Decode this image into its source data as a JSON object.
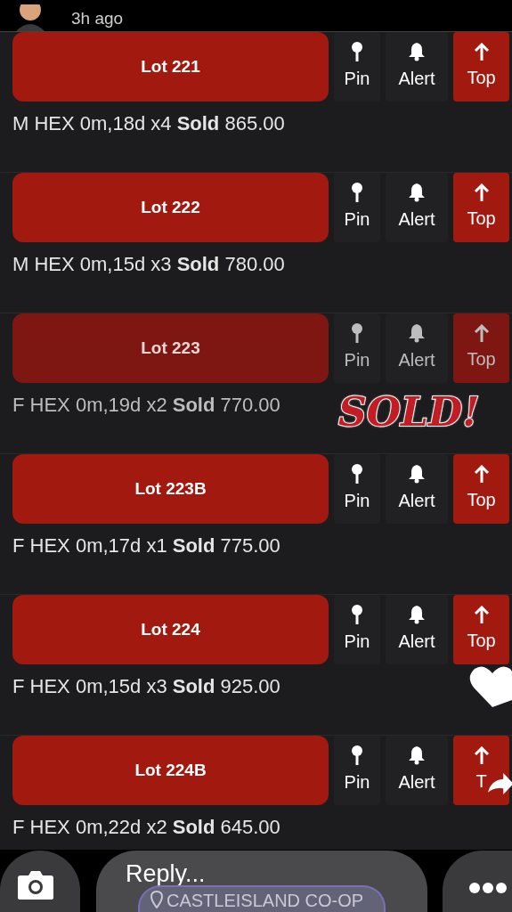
{
  "story_header": {
    "time": "3h ago"
  },
  "lots": [
    {
      "lot": "Lot 221",
      "description": "M HEX 0m,18d x4 **Sold** 865.00",
      "dimmed": false,
      "pin": "Pin",
      "alert": "Alert",
      "top": "Top"
    },
    {
      "lot": "Lot 222",
      "description": "M HEX 0m,15d x3 **Sold** 780.00",
      "dimmed": false,
      "pin": "Pin",
      "alert": "Alert",
      "top": "Top"
    },
    {
      "lot": "Lot 223",
      "description": "F HEX 0m,19d x2 **Sold** 770.00",
      "dimmed": true,
      "pin": "Pin",
      "alert": "Alert",
      "top": "Top"
    },
    {
      "lot": "Lot 223B",
      "description": "F HEX 0m,17d x1 **Sold** 775.00",
      "dimmed": false,
      "pin": "Pin",
      "alert": "Alert",
      "top": "Top"
    },
    {
      "lot": "Lot 224",
      "description": "F HEX 0m,15d x3 **Sold** 925.00",
      "dimmed": false,
      "pin": "Pin",
      "alert": "Alert",
      "top": "Top"
    },
    {
      "lot": "Lot 224B",
      "description": "F HEX 0m,22d x2 **Sold** 645.00",
      "dimmed": false,
      "pin": "Pin",
      "alert": "Alert",
      "top": "T"
    }
  ],
  "sticker": {
    "text": "SOLD!"
  },
  "location_sticker": {
    "text": "CASTLEISLAND CO-OP"
  },
  "reply_bar": {
    "placeholder": "Reply..."
  }
}
